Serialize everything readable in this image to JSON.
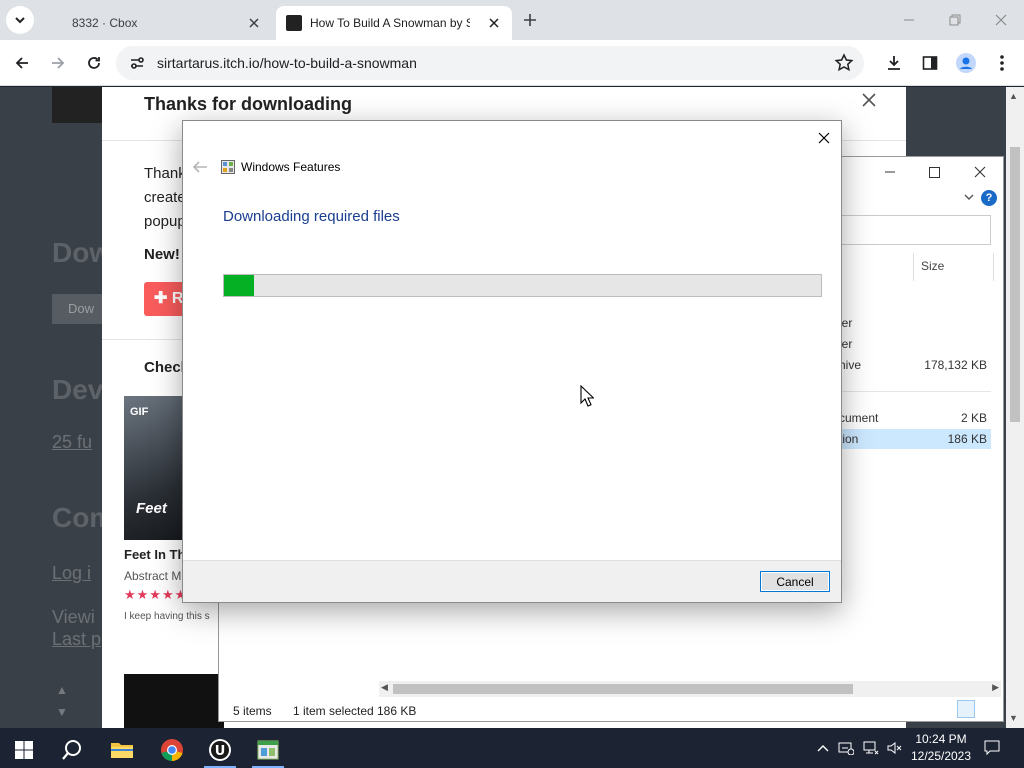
{
  "browser": {
    "tabs": [
      {
        "label": "8332 · Cbox"
      },
      {
        "label": "How To Build A Snowman by Si"
      }
    ],
    "url": "sirtartarus.itch.io/how-to-build-a-snowman"
  },
  "page": {
    "bg_texts": [
      "Dow",
      "Dev",
      "Com"
    ],
    "bg_links": [
      "25 fu",
      "Log i",
      "Viewi",
      "Last p"
    ],
    "bg_button": "Dow",
    "modal": {
      "title": "Thanks for downloading",
      "body_lines": [
        "Thank",
        "create",
        "popup"
      ],
      "new_label": "New!",
      "red_button_label": "R",
      "check_title": "Check",
      "game": {
        "gif_tag": "GIF",
        "thumb_text": "Feet",
        "title": "Feet In Th",
        "author": "Abstract M",
        "stars": "★★★★★",
        "description": "I keep having this s"
      }
    }
  },
  "explorer": {
    "size_header": "Size",
    "rows": [
      {
        "type": "ler",
        "size": ""
      },
      {
        "type": "ler",
        "size": ""
      },
      {
        "type": "hive",
        "size": "178,132 KB"
      },
      {
        "type": "cument",
        "size": "2 KB"
      },
      {
        "type": "tion",
        "size": "186 KB"
      }
    ],
    "status": {
      "items": "5 items",
      "selected": "1 item selected",
      "size": "186 KB"
    },
    "help_label": "?"
  },
  "dialog": {
    "title": "Windows Features",
    "heading": "Downloading required files",
    "progress": 0.05,
    "cancel_label": "Cancel"
  },
  "taskbar": {
    "time": "10:24 PM",
    "date": "12/25/2023"
  },
  "colors": {
    "progress_fill": "#06b025",
    "dialog_heading": "#1a3e8f",
    "accent": "#0078d7"
  }
}
